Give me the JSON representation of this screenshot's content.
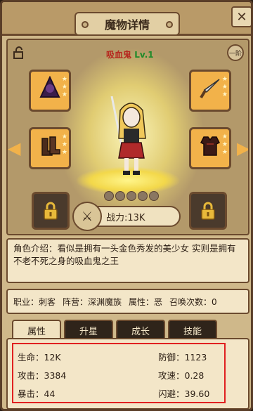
{
  "header": {
    "title": "魔物详情",
    "close_icon": "close-icon"
  },
  "monster": {
    "name": "吸血鬼",
    "level": "Lv.1",
    "rank_badge": "一阶"
  },
  "colors": {
    "name": "#b6281f",
    "level": "#1f8a2a",
    "slot_bg": "#f2b24a",
    "highlight_box": "#e02020"
  },
  "equipment": [
    {
      "icon": "hood-icon",
      "glyph": "🧥",
      "stars": 3
    },
    {
      "icon": "dagger-icon",
      "glyph": "🗡",
      "stars": 3
    },
    {
      "icon": "boots-icon",
      "glyph": "👢",
      "stars": 3
    },
    {
      "icon": "armor-icon",
      "glyph": "🦺",
      "stars": 3
    }
  ],
  "power": {
    "label": "战力:13K",
    "icon": "crossed-swords-icon"
  },
  "description": "角色介绍：看似是拥有一头金色秀发的美少女 实则是拥有不老不死之身的吸血鬼之王",
  "info": {
    "job": "职业：刺客",
    "faction": "阵营：深渊魔族",
    "attribute": "属性：恶",
    "summons": "召唤次数：0"
  },
  "tabs": [
    "属性",
    "升星",
    "成长",
    "技能"
  ],
  "stats": {
    "hp": "生命：12K",
    "attack": "攻击：3384",
    "crit": "暴击：44",
    "defense": "防御：1123",
    "atk_speed": "攻速：0.28",
    "dodge": "闪避：39.60"
  }
}
